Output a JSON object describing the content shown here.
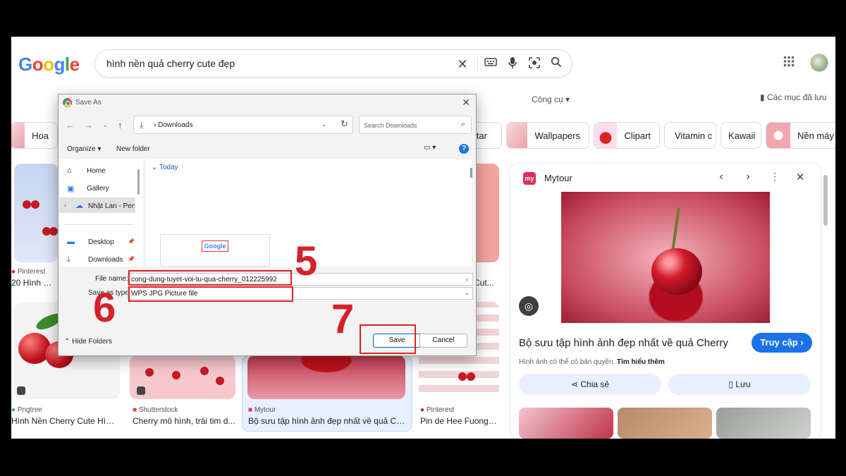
{
  "search": {
    "query": "hình nền quả cherry cute đẹp"
  },
  "header": {
    "logo": "Google",
    "tools_label": "Công cụ",
    "saved_label": "Các mục đã lưu"
  },
  "chips": [
    {
      "label": "Hoa"
    },
    {
      "label": "vatar"
    },
    {
      "label": "Wallpapers"
    },
    {
      "label": "Clipart"
    },
    {
      "label": "Vitamin c"
    },
    {
      "label": "Kawaii"
    },
    {
      "label": "Nền máy"
    }
  ],
  "results": [
    {
      "source": "Pinterest",
      "title": "20 Hình nền c..."
    },
    {
      "source": "Pngtree",
      "title": "Hình Nền Cherry Cute Hình..."
    },
    {
      "source": "Shutterstock",
      "title": "Cherry mô hình, trái tim d..."
    },
    {
      "source": "Mytour",
      "title": "Bộ sưu tập hình ảnh đẹp nhất về quả Che..."
    },
    {
      "source": "Pinterest",
      "title": "Pin de Hee Fuong ..."
    },
    {
      "title": "Cut..."
    }
  ],
  "panel": {
    "source_logo": "my",
    "source_name": "Mytour",
    "title": "Bộ sưu tập hình ảnh đẹp nhất về quả Cherry",
    "visit_label": "Truy cập",
    "rights_text": "Hình ảnh có thể có bản quyền.",
    "learn_more": "Tìm hiểu thêm",
    "share_label": "Chia sẻ",
    "save_label": "Lưu"
  },
  "dialog": {
    "title": "Save As",
    "path": "Downloads",
    "search_placeholder": "Search Downloads",
    "organize_label": "Organize",
    "new_folder_label": "New folder",
    "sidebar": [
      {
        "label": "Home"
      },
      {
        "label": "Gallery"
      },
      {
        "label": "Nhật Lan - Perso"
      },
      {
        "label": "Desktop"
      },
      {
        "label": "Downloads"
      }
    ],
    "group_today": "Today",
    "thumb_logo": "Google",
    "file_name_label": "File name:",
    "file_name_value": "cong-dung-tuyet-voi-tu-qua-cherry_012225992",
    "save_type_label": "Save as type:",
    "save_type_value": "WPS JPG Picture file",
    "hide_folders_label": "Hide Folders",
    "save_button": "Save",
    "cancel_button": "Cancel"
  },
  "annotations": {
    "step_5": "5",
    "step_6": "6",
    "step_7": "7"
  },
  "colors": {
    "annotation_red": "#d6202a",
    "google_blue": "#1a73e8"
  }
}
